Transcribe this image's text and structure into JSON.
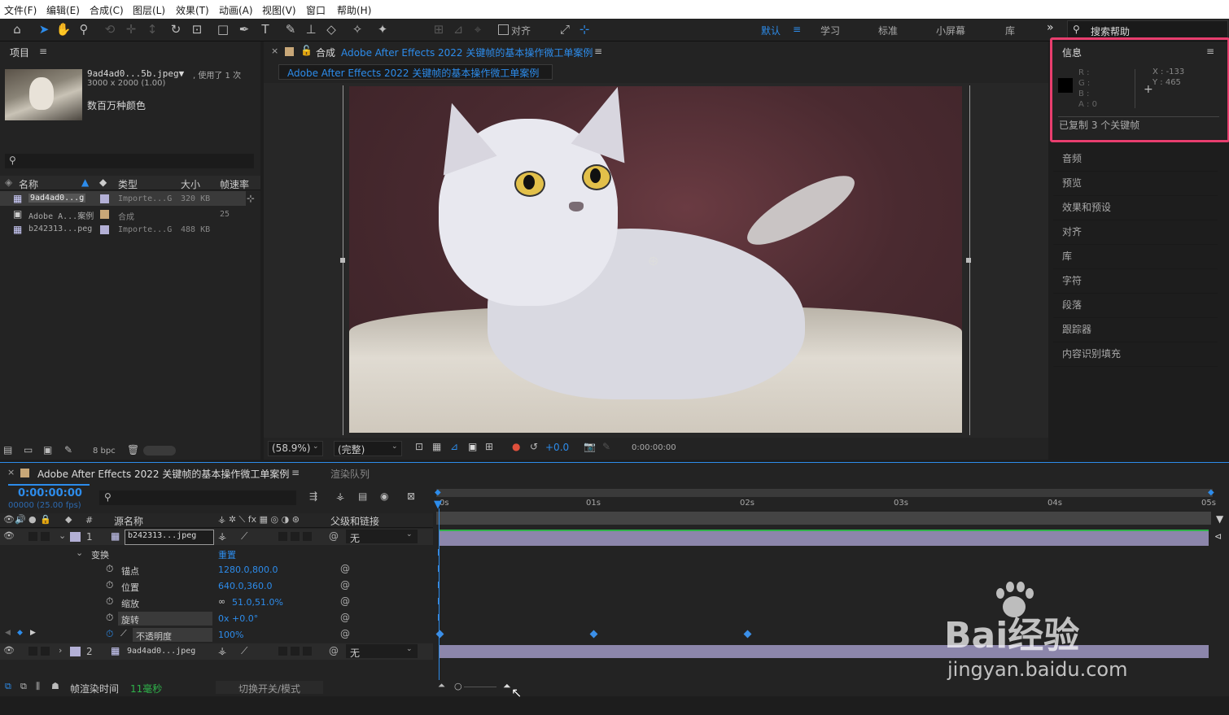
{
  "menu": [
    "文件(F)",
    "编辑(E)",
    "合成(C)",
    "图层(L)",
    "效果(T)",
    "动画(A)",
    "视图(V)",
    "窗口",
    "帮助(H)"
  ],
  "toolbar": {
    "align_label": "对齐",
    "workspaces": [
      "默认",
      "学习",
      "标准",
      "小屏幕",
      "库"
    ],
    "more": "»",
    "search_placeholder": "搜索帮助"
  },
  "project": {
    "title": "项目",
    "file_name": "9ad4ad0...5b.jpeg▼",
    "used": ", 使用了 1 次",
    "dimensions": "3000 x 2000 (1.00)",
    "colors": "数百万种颜色",
    "columns": [
      "名称",
      "类型",
      "大小",
      "帧速率"
    ],
    "rows": [
      {
        "name": "9ad4ad0...g",
        "type": "Importe...G",
        "size": "320 KB",
        "fps": ""
      },
      {
        "name": "Adobe A...案例",
        "type": "合成",
        "size": "",
        "fps": "25"
      },
      {
        "name": "b242313...peg",
        "type": "Importe...G",
        "size": "488 KB",
        "fps": ""
      }
    ],
    "bpc": "8 bpc"
  },
  "composition": {
    "tab_prefix": "合成",
    "tab_name": "Adobe After Effects 2022 关键帧的基本操作微工单案例",
    "breadcrumb": "Adobe After Effects 2022 关键帧的基本操作微工单案例",
    "zoom": "(58.9%)",
    "quality": "(完整)",
    "exposure": "+0.0",
    "timecode": "0:00:00:00"
  },
  "info": {
    "title": "信息",
    "r": "R :",
    "g": "G :",
    "b": "B :",
    "a": "A : 0",
    "x": "X : -133",
    "y": "Y : 465",
    "status": "已复制 3 个关键帧"
  },
  "right_panels": [
    "音频",
    "预览",
    "效果和预设",
    "对齐",
    "库",
    "字符",
    "段落",
    "跟踪器",
    "内容识别填充"
  ],
  "timeline": {
    "tab_name": "Adobe After Effects 2022 关键帧的基本操作微工单案例",
    "render_queue": "渲染队列",
    "timecode": "0:00:00:00",
    "frame_info": "00000 (25.00 fps)",
    "col_source": "源名称",
    "col_parent": "父级和链接",
    "ruler": [
      "0s",
      "01s",
      "02s",
      "03s",
      "04s",
      "05s"
    ],
    "layers": [
      {
        "num": "1",
        "name": "b242313...jpeg",
        "parent": "无"
      },
      {
        "num": "2",
        "name": "9ad4ad0...jpeg",
        "parent": "无"
      }
    ],
    "transform_label": "变换",
    "reset_label": "重置",
    "props": [
      {
        "name": "锚点",
        "value": "1280.0,800.0"
      },
      {
        "name": "位置",
        "value": "640.0,360.0"
      },
      {
        "name": "缩放",
        "value": "51.0,51.0%"
      },
      {
        "name": "旋转",
        "value": "0x +0.0°"
      },
      {
        "name": "不透明度",
        "value": "100%"
      }
    ],
    "render_time_label": "帧渲染时间",
    "render_time_value": "11毫秒",
    "toggle_label": "切换开关/模式"
  },
  "watermark": {
    "brand": "Bai经验",
    "url": "jingyan.baidu.com"
  },
  "colors": {
    "accent": "#2d8ceb",
    "highlight_box": "#e83e6e",
    "layer_bar": "#8c86ab"
  }
}
